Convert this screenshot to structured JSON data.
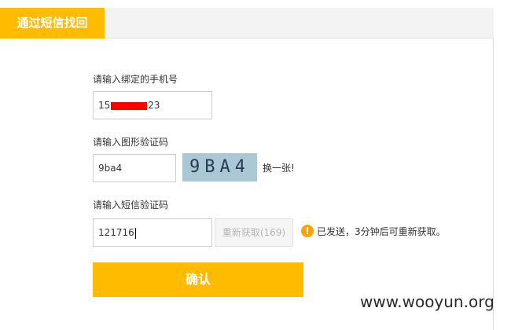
{
  "header": {
    "tab_label": "通过短信找回"
  },
  "form": {
    "phone": {
      "label": "请输入绑定的手机号",
      "prefix": "15",
      "suffix": "23"
    },
    "captcha": {
      "label": "请输入图形验证码",
      "value": "9ba4",
      "image_text": "9BA4",
      "refresh_label": "换一张!"
    },
    "sms": {
      "label": "请输入短信验证码",
      "value": "121716",
      "resend_label": "重新获取(169)",
      "notice_text": "已发送，3分钟后可重新获取。"
    },
    "confirm_label": "确认"
  },
  "colors": {
    "accent": "#ffbb00",
    "notice_icon": "#f5a400",
    "redaction": "#ff0000",
    "captcha_bg": "#a9c8d4"
  },
  "watermark": "www.wooyun.org"
}
